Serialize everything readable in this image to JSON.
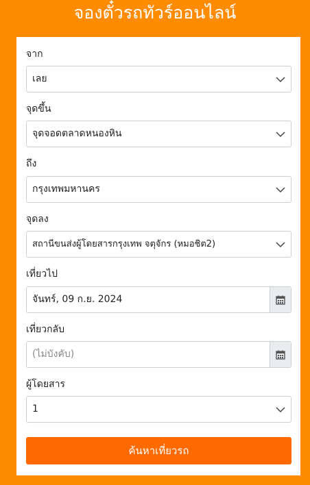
{
  "page": {
    "title": "จองตั๋วรถทัวร์ออนไลน์"
  },
  "form": {
    "from": {
      "label": "จาก",
      "value": "เลย"
    },
    "boarding": {
      "label": "จุดขึ้น",
      "value": "จุดจอดตลาดหนองหิน"
    },
    "to": {
      "label": "ถึง",
      "value": "กรุงเทพมหานคร"
    },
    "dropoff": {
      "label": "จุดลง",
      "value": "สถานีขนส่งผู้โดยสารกรุงเทพ จตุจักร (หมอชิต2)"
    },
    "depart": {
      "label": "เที่ยวไป",
      "value": "จันทร์, 09 ก.ย. 2024"
    },
    "return": {
      "label": "เที่ยวกลับ",
      "value": "",
      "placeholder": "(ไม่บังคับ)"
    },
    "passengers": {
      "label": "ผู้โดยสาร",
      "value": "1"
    },
    "search_label": "ค้นหาเที่ยวรถ"
  },
  "icons": {
    "select": "chevron-down-icon",
    "date": "calendar-icon"
  },
  "colors": {
    "background": "#ff8c00",
    "button": "#ff6a00"
  }
}
